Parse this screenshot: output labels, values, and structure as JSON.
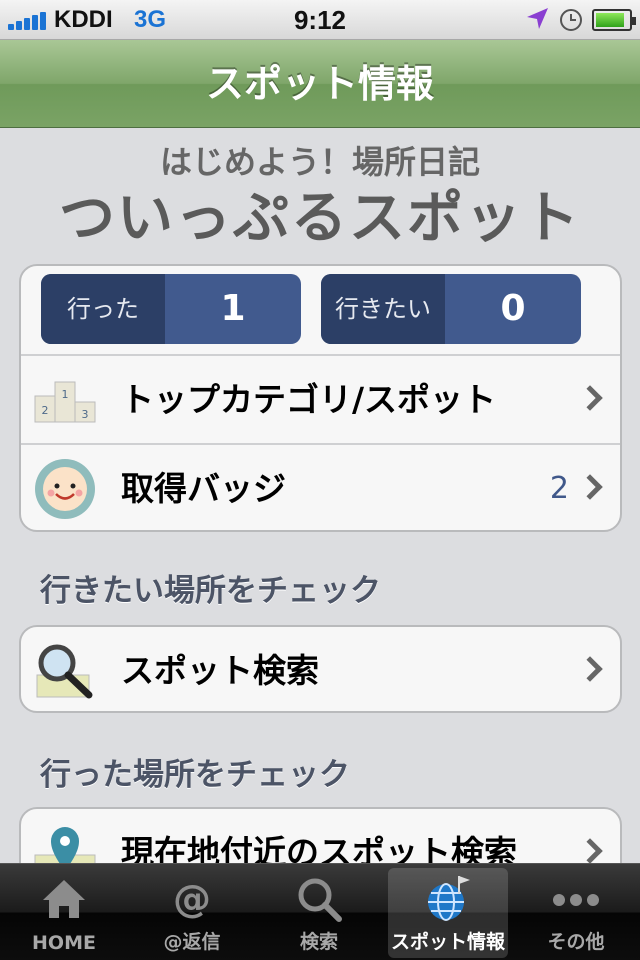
{
  "status_bar": {
    "carrier": "KDDI",
    "network": "3G",
    "time": "9:12",
    "battery_level": 0.9
  },
  "nav": {
    "title": "スポット情報"
  },
  "hero": {
    "subtitle": "はじめよう！場所日記",
    "title": "ついっぷるスポット"
  },
  "counts": {
    "went_label": "行った",
    "went_value": "1",
    "want_label": "行きたい",
    "want_value": "0"
  },
  "rows": {
    "top_category": "トップカテゴリ/スポット",
    "badges": "取得バッジ",
    "badges_count": "2",
    "spot_search": "スポット検索",
    "nearby_search": "現在地付近のスポット検索"
  },
  "sections": {
    "want_header": "行きたい場所をチェック",
    "went_header": "行った場所をチェック"
  },
  "tabs": [
    {
      "label": "HOME",
      "icon": "home-icon"
    },
    {
      "label": "@返信",
      "icon": "at-icon"
    },
    {
      "label": "検索",
      "icon": "search-icon"
    },
    {
      "label": "スポット情報",
      "icon": "globe-flag-icon"
    },
    {
      "label": "その他",
      "icon": "more-icon"
    }
  ],
  "colors": {
    "nav_green": "#7fa66a",
    "count_blue": "#415a8e",
    "count_dark": "#2c3f66",
    "section_text": "#4c5466"
  }
}
